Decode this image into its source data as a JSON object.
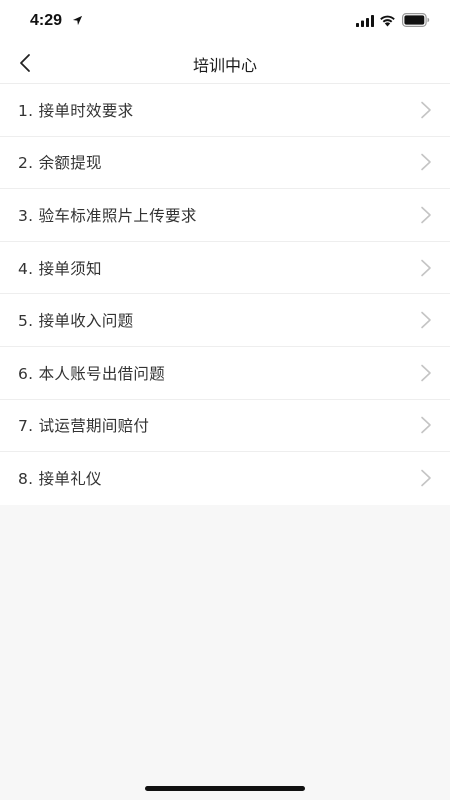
{
  "status_bar": {
    "time": "4:29",
    "icons": [
      "location-arrow-icon",
      "cellular-signal-icon",
      "wifi-icon",
      "battery-icon"
    ]
  },
  "nav": {
    "title": "培训中心",
    "back_icon": "chevron-left-icon"
  },
  "list": {
    "items": [
      {
        "label": "1. 接单时效要求"
      },
      {
        "label": "2. 余额提现"
      },
      {
        "label": "3. 验车标准照片上传要求"
      },
      {
        "label": "4. 接单须知"
      },
      {
        "label": "5. 接单收入问题"
      },
      {
        "label": "6. 本人账号出借问题"
      },
      {
        "label": "7. 试运营期间赔付"
      },
      {
        "label": "8. 接单礼仪"
      }
    ],
    "item_icon": "chevron-right-icon"
  },
  "colors": {
    "background": "#f7f7f7",
    "surface": "#ffffff",
    "text": "#333333",
    "chevron": "#c4c4c4"
  }
}
